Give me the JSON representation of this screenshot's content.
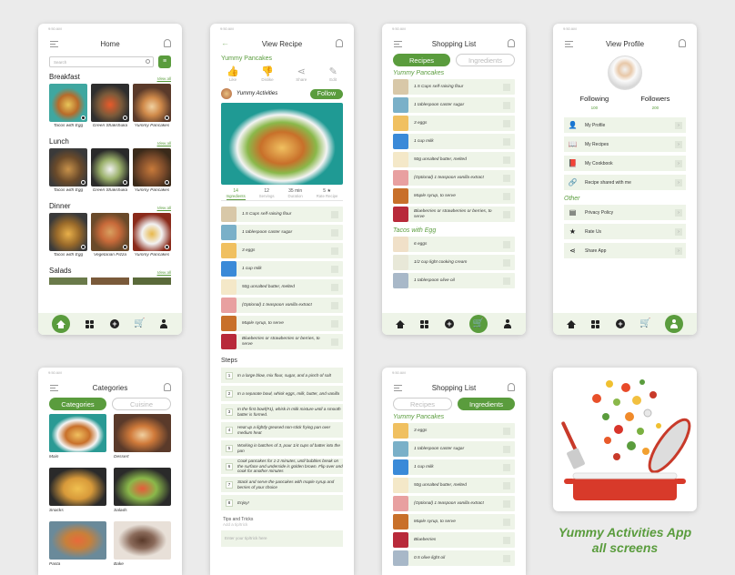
{
  "status_time": "9:50 AM",
  "home": {
    "title": "Home",
    "search_placeholder": "Search",
    "view_all": "View all",
    "sections": [
      {
        "name": "Breakfast",
        "items": [
          "Tacos with Egg",
          "Green Shakshuka",
          "Yummy Pancakes"
        ]
      },
      {
        "name": "Lunch",
        "items": [
          "Tacos with Egg",
          "Green Shakshuka",
          "Yummy Pancakes"
        ]
      },
      {
        "name": "Dinner",
        "items": [
          "Tacos with Egg",
          "Vegetarian Pizza",
          "Yummy Pancakes"
        ]
      },
      {
        "name": "Salads",
        "items": []
      }
    ]
  },
  "view_recipe": {
    "title": "View Recipe",
    "recipe_name": "Yummy Pancakes",
    "actions": [
      "Like",
      "Dislike",
      "Share",
      "Edit"
    ],
    "author": "Yummy Activities",
    "follow": "Follow",
    "stats": [
      {
        "value": "14",
        "label": "Ingredients"
      },
      {
        "value": "12",
        "label": "Servings"
      },
      {
        "value": "35 min",
        "label": "Duration"
      },
      {
        "value": "5 ★",
        "label": "Rate Recipe"
      }
    ],
    "ingredients": [
      "1.5 Cups self-raising flour",
      "1 tablespoon caster sugar",
      "3 eggs",
      "1 cup milk",
      "50g unsalted butter, melted",
      "(Optional) 1 teaspoon vanilla extract",
      "Maple syrup, to serve",
      "Blueberries or strawberries or berries, to serve"
    ],
    "steps_title": "Steps",
    "steps": [
      "In a large blow, mix flour, sugar, and a pinch of salt",
      "In a separate bowl, whisk eggs, milk, butter, and vanilla",
      "In the first bowl(#1), whisk in milk mixture until a smooth batter is formed.",
      "Heat up a lightly greased non-stick frying pan over medium heat",
      "Working in batches of 3, pour 1/4 cups of batter into the pan",
      "Cook pancakes for 1-2 minutes, until bubbles break on the surface and underside is golden brown. Flip over and cook for another minutes",
      "Stack and serve the pancakes with maple syrup and berries of your choice",
      "Enjoy!"
    ],
    "tips_title": "Tips and Tricks",
    "tips_sub": "Add a tip/trick",
    "tip_placeholder": "Enter your tip/trick here"
  },
  "shopping1": {
    "title": "Shopping List",
    "tabs": [
      "Recipes",
      "Ingredients"
    ],
    "groups": [
      {
        "name": "Yummy Pancakes",
        "items": [
          "1.5 Cups self-raising flour",
          "1 tablespoon caster sugar",
          "3 eggs",
          "1 cup milk",
          "50g unsalted butter, melted",
          "(Optional) 1 teaspoon vanilla extract",
          "Maple syrup, to serve",
          "Blueberries or strawberries or berries, to serve"
        ]
      },
      {
        "name": "Tacos with Egg",
        "items": [
          "6 eggs",
          "1/2 cup light cooking cream",
          "1 tablespoon olive oil"
        ]
      }
    ]
  },
  "profile": {
    "title": "View Profile",
    "following_label": "Following",
    "following_count": "100",
    "followers_label": "Followers",
    "followers_count": "200",
    "menu": [
      "My Profile",
      "My Recipes",
      "My Cookbook",
      "Recipe shared with me"
    ],
    "other_title": "Other",
    "other": [
      "Privacy Policy",
      "Rate Us",
      "Share App"
    ]
  },
  "categories": {
    "title": "Categories",
    "tabs": [
      "Categories",
      "Cuisine"
    ],
    "items": [
      "Main",
      "Dessert",
      "Snacks",
      "Salads",
      "Pasta",
      "Bake"
    ]
  },
  "shopping2": {
    "title": "Shopping List",
    "tabs": [
      "Recipes",
      "Ingredients"
    ],
    "group": "Yummy Pancakes",
    "items": [
      "3 eggs",
      "1 tablespoon caster sugar",
      "1 cup milk",
      "50g unsalted butter, melted",
      "(Optional) 1 teaspoon vanilla extract",
      "Maple syrup, to serve",
      "Blueberries",
      "0.5 olive light oil"
    ]
  },
  "app_title_line1": "Yummy Activities App",
  "app_title_line2": "all screens",
  "colors": {
    "accent": "#5a9c3d",
    "row_bg": "#eef4e8"
  }
}
